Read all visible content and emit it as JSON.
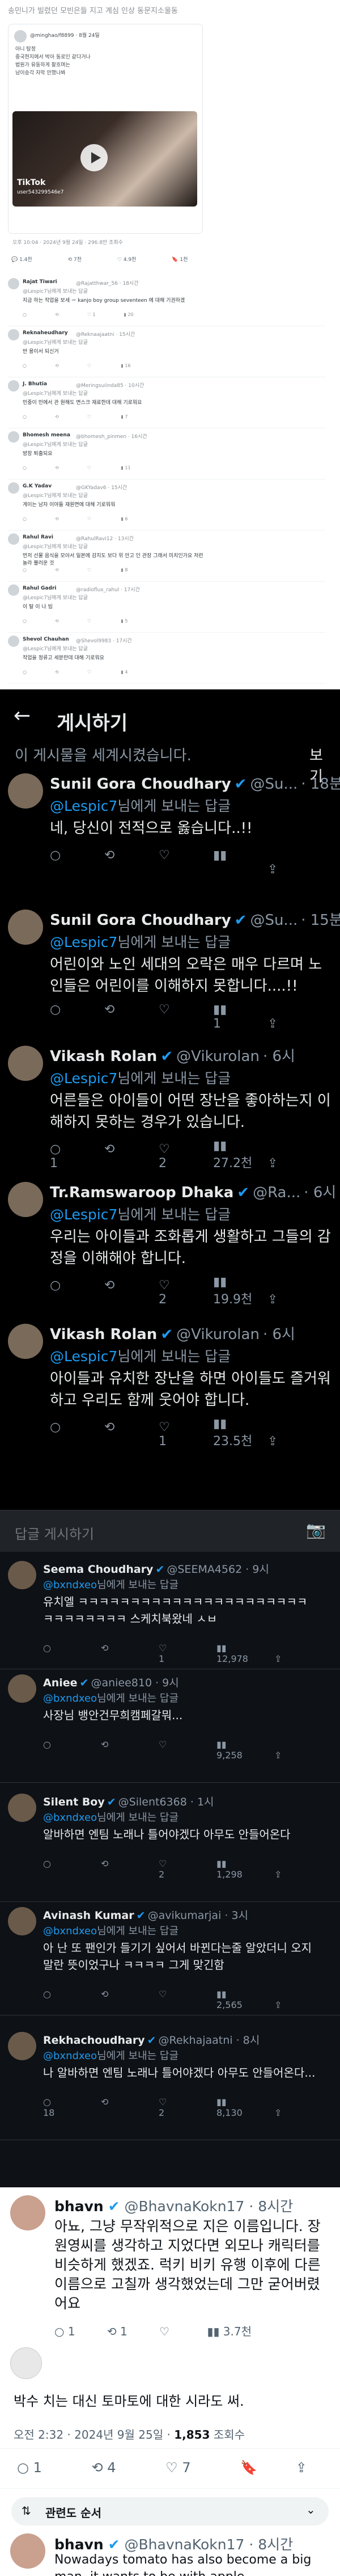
{
  "post_header": "송민니가 빌렸던 모빈은들 지고 계심 인상 동문지소울동",
  "card": {
    "user": "@minghao/f8899 · 8월 24일",
    "lines": [
      "아니 탐정",
      "중국현지에서 박아 동로인 같다거나",
      "법원가 유동하게 찰흐며는",
      "남이승각 자막 안했나봐"
    ],
    "tiktok_label": "TikTok",
    "tiktok_user": "user543299546e7"
  },
  "post_meta": "오후 10:04 · 2024년 9월 24일 · 296.8만 조회수",
  "post_actions": {
    "reply": "1.4천",
    "retweet": "7천",
    "like": "4.9천",
    "bookmark": "1천"
  },
  "light_replies": [
    {
      "name": "Rajat Tiwari",
      "handle": "@Rajatthwar_56 · 18시간",
      "reply_to": "@Lespic7님에게 보내는 답글",
      "body": "지금 하는 작업을 보세 ᅲ kanjo boy group seventeen 에 대해 기권하겠",
      "c": "",
      "r": "",
      "l": "1",
      "v": "20"
    },
    {
      "name": "Reknaheudhary",
      "handle": "@Reknaajaatni · 15시간",
      "reply_to": "@Lespic7님에게 보내는 답글",
      "body": "반 용이서 되신거",
      "c": "",
      "r": "",
      "l": "",
      "v": "16"
    },
    {
      "name": "J. Bhutia",
      "handle": "@Meringsuiinda85 · 10시간",
      "reply_to": "@Lespic7님에게 보내는 답글",
      "body": "민중이 민에서 관 원해도 면스크 재료한데 대해 기로워요",
      "c": "",
      "r": "",
      "l": "",
      "v": "7"
    },
    {
      "name": "Bhomesh meena",
      "handle": "@bhomesh_pinmen · 16시간",
      "reply_to": "@Lespic7님에게 보내는 답글",
      "body": "방장 퇴출되요",
      "c": "",
      "r": "",
      "l": "",
      "v": "11"
    },
    {
      "name": "G.K Yadav",
      "handle": "@GKYadav6 · 15시간",
      "reply_to": "@Lespic7님에게 보내는 답글",
      "body": "게이는 남자 이야들 재원면에 대해 기로워워",
      "c": "",
      "r": "",
      "l": "",
      "v": "6"
    },
    {
      "name": "Rahul Ravi",
      "handle": "@RahulRavi12 · 13시간",
      "reply_to": "@Lespic7님에게 보내는 답글",
      "body": "먼저 선물 음식을 모아서 일본에 감지도 보다 위 안고 인 관장 그래서 미치인가요 저런 놀라 뿔러운 것",
      "c": "",
      "r": "",
      "l": "",
      "v": "8"
    },
    {
      "name": "Rahul Gadri",
      "handle": "@radioflux_rahul · 17시간",
      "reply_to": "@Lespic7님에게 보내는 답글",
      "body": "이 탈 이 나 빔",
      "c": "",
      "r": "",
      "l": "",
      "v": "5"
    },
    {
      "name": "Shevol Chauhan",
      "handle": "@Shevol9983 · 17시간",
      "reply_to": "@Lespic7님에게 보내는 답글",
      "body": "작업을 정류고 세분란데 대해 기로워요",
      "c": "",
      "r": "",
      "l": "",
      "v": "4"
    }
  ],
  "dark_thread": {
    "title": "게시하기",
    "notice": "이 게시물을 세계시켰습니다.",
    "notice_right": "보기",
    "replies": [
      {
        "name": "Sunil Gora Choudhary",
        "handle": "@Su...",
        "time": "· 18분",
        "reply_to": "@Lespic7",
        "reply_suffix": "님에게 보내는 답글",
        "body": "네, 당신이 전적으로 옳습니다..!!",
        "c": "",
        "r": "",
        "l": "",
        "v": ""
      },
      {
        "name": "Sunil Gora Choudhary",
        "handle": "@Su...",
        "time": "· 15분",
        "reply_to": "@Lespic7",
        "reply_suffix": "님에게 보내는 답글",
        "body": "어린이와 노인 세대의 오락은 매우 다르며 노인들은 어린이를 이해하지 못합니다....!!",
        "c": "",
        "r": "",
        "l": "",
        "v": "1"
      },
      {
        "name": "Vikash Rolan",
        "handle": "@Vikurolan",
        "time": "· 6시",
        "reply_to": "@Lespic7",
        "reply_suffix": "님에게 보내는 답글",
        "body": "어른들은 아이들이 어떤 장난을 좋아하는지 이해하지 못하는 경우가 있습니다.",
        "c": "1",
        "r": "",
        "l": "2",
        "v": "27.2천"
      },
      {
        "name": "Tr.Ramswaroop Dhaka",
        "handle": "@Ra...",
        "time": "· 6시",
        "reply_to": "@Lespic7",
        "reply_suffix": "님에게 보내는 답글",
        "body": "우리는 아이들과 조화롭게 생활하고 그들의 감정을 이해해야 합니다.",
        "c": "",
        "r": "",
        "l": "2",
        "v": "19.9천"
      },
      {
        "name": "Vikash Rolan",
        "handle": "@Vikurolan",
        "time": "· 6시",
        "reply_to": "@Lespic7",
        "reply_suffix": "님에게 보내는 답글",
        "body": "아이들과 유치한 장난을 하면 아이들도 즐거워하고 우리도 함께 웃어야 합니다.",
        "c": "",
        "r": "",
        "l": "1",
        "v": "23.5천"
      }
    ],
    "compose_placeholder": "답글 게시하기"
  },
  "emoji_thread": [
    {
      "name": "Seema Choudhary",
      "handle": "@SEEMA4562 · 9시",
      "reply_to": "@bxndxeo",
      "reply_suffix": "님에게 보내는 답글",
      "body": "유치엘 ㅋㅋㅋㅋㅋㅋㅋㅋㅋㅋㅋㅋㅋㅋㅋㅋㅋㅋㅋㅋㅋㅋ",
      "body2": "ㅋㅋㅋㅋㅋㅋㅋㅋ 스케치북왔네 ㅅㅂ",
      "c": "",
      "r": "",
      "l": "1",
      "v": "12,978"
    },
    {
      "name": "Aniee",
      "handle": "@aniee810 · 9시",
      "reply_to": "@bxndxeo",
      "reply_suffix": "님에게 보내는 답글",
      "body": "사장님 뱅안건무희캠페갈뭐...",
      "body2": "",
      "c": "",
      "r": "",
      "l": "",
      "v": "9,258"
    },
    {
      "name": "Silent Boy",
      "handle": "@Silent6368 · 1시",
      "reply_to": "@bxndxeo",
      "reply_suffix": "님에게 보내는 답글",
      "body": "알바하면 엔팀 노래나 틀어야겠다 아무도 안들어온다",
      "body2": "",
      "c": "",
      "r": "",
      "l": "2",
      "v": "1,298"
    },
    {
      "name": "Avinash Kumar",
      "handle": "@avikumarjai · 3시",
      "reply_to": "@bxndxeo",
      "reply_suffix": "님에게 보내는 답글",
      "body": "아 난 또 팬인가 들기기 싶어서 바뀐다는줄 알았더니 오지",
      "body2": "말란 뜻이었구나 ㅋㅋㅋㅋ 그게 맞긴함",
      "c": "",
      "r": "",
      "l": "",
      "v": "2,565"
    },
    {
      "name": "Rekhachoudhary",
      "handle": "@Rekhajaatni · 8시",
      "reply_to": "@bxndxeo",
      "reply_suffix": "님에게 보내는 답글",
      "body": "나 알바하면 엔팀 노래나 틀어야겠다 아무도 안들어온다...",
      "body2": "",
      "c": "18",
      "r": "",
      "l": "2",
      "v": "8,130"
    }
  ],
  "bottom": {
    "name": "bhavn",
    "handle": "@BhavnaKokn17",
    "time": "· 8시간",
    "body": "아뇨, 그냥 무작위적으로 지은 이름입니다. 장원영씨를 생각하고 지었다면 외모나 캐릭터를 비슷하게 했겠죠. 럭키 비키 유행 이후에 다른 이름으로 고칠까 생각했었는데 그만 굳어버렸어요",
    "c": "1",
    "r": "1",
    "l": "",
    "v": "3.7천",
    "main_text": "박수 치는 대신 토마토에 대한 시라도 써.",
    "main_meta_time": "오전 2:32 · 2024년 9월 25일 · ",
    "main_meta_views": "1,853",
    "main_meta_suffix": " 조회수",
    "main_actions": {
      "reply": "1",
      "retweet": "4",
      "like": "7"
    },
    "sort_label": "관련도 순서",
    "last_name": "bhavn",
    "last_handle": "@BhavnaKokn17",
    "last_time": "· 8시간",
    "last_body": "Nowadays tomato has also become a big man, it wants to be with apple."
  }
}
